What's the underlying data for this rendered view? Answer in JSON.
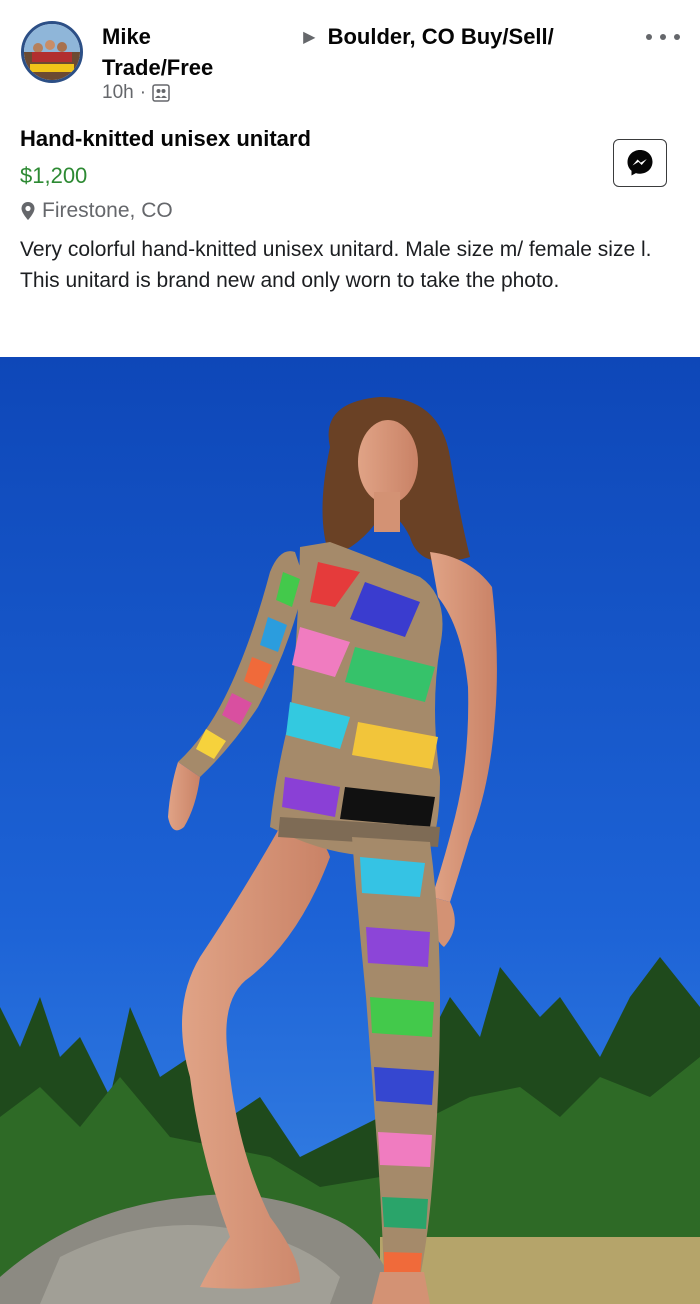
{
  "post": {
    "author": "Mike",
    "group": "Boulder, CO Buy/Sell/",
    "group_line2": "Trade/Free",
    "time": "10h",
    "separator": "·"
  },
  "listing": {
    "title": "Hand-knitted unisex unitard",
    "price": "$1,200",
    "location": "Firestone, CO",
    "description": "Very colorful hand-knitted unisex unitard. Male size m/ female size l. This unitard is brand new and only worn to take the photo."
  },
  "icons": {
    "more": "more-options-icon",
    "messenger": "messenger-icon",
    "location": "location-pin-icon",
    "group": "group-privacy-icon"
  },
  "colors": {
    "price": "#2d8a33",
    "secondary_text": "#65676b",
    "sky": "#1c5fd0"
  }
}
